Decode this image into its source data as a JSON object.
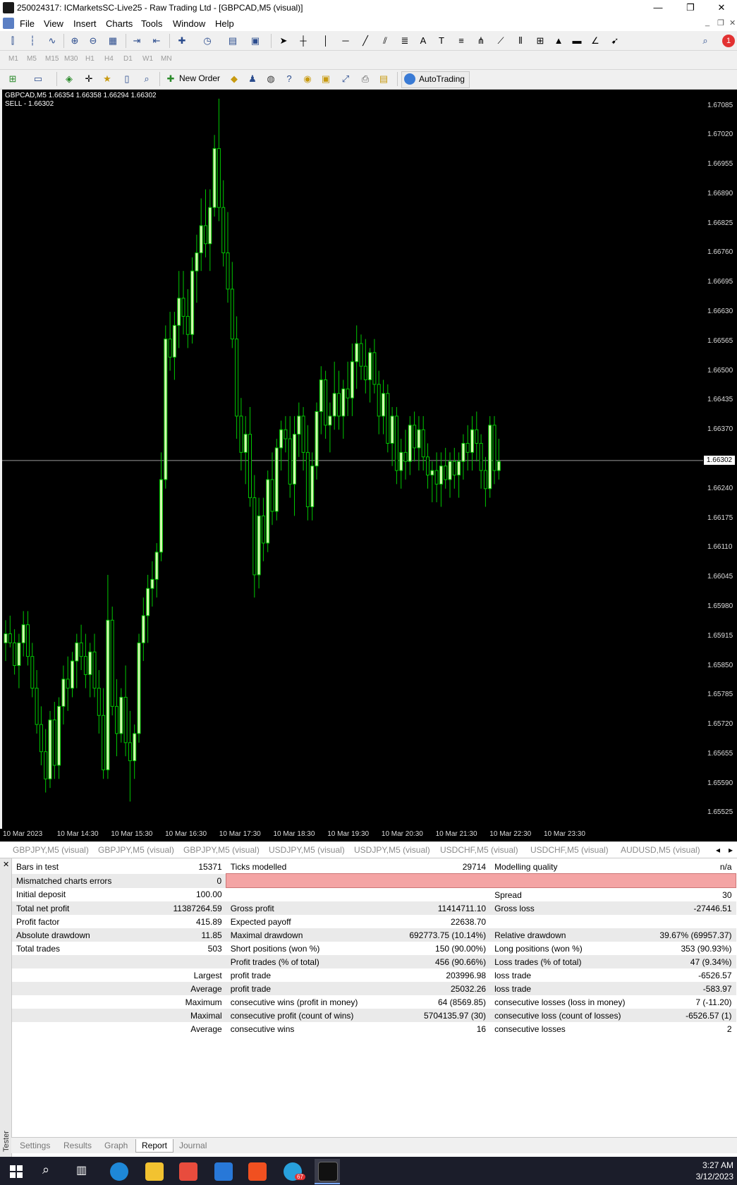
{
  "window": {
    "title": "250024317: ICMarketsSC-Live25 - Raw Trading Ltd - [GBPCAD,M5 (visual)]",
    "minimize": "—",
    "maximize": "❐",
    "close": "✕"
  },
  "menu": {
    "items": [
      "File",
      "View",
      "Insert",
      "Charts",
      "Tools",
      "Window",
      "Help"
    ],
    "mdi_min": "_",
    "mdi_restore": "❐",
    "mdi_close": "✕"
  },
  "timeframes": [
    "M1",
    "M5",
    "M15",
    "M30",
    "H1",
    "H4",
    "D1",
    "W1",
    "MN"
  ],
  "toolbar": {
    "new_order": "New Order",
    "autotrading": "AutoTrading",
    "notification_count": "1"
  },
  "chart": {
    "symbol_line": "GBPCAD,M5  1.66354 1.66358 1.66294 1.66302",
    "order_line": "SELL - 1.66302",
    "current_price": "1.66302",
    "price_ticks": [
      "1.67085",
      "1.67020",
      "1.66955",
      "1.66890",
      "1.66825",
      "1.66760",
      "1.66695",
      "1.66630",
      "1.66565",
      "1.66500",
      "1.66435",
      "1.66370",
      "1.66240",
      "1.66175",
      "1.66110",
      "1.66045",
      "1.65980",
      "1.65915",
      "1.65850",
      "1.65785",
      "1.65720",
      "1.65655",
      "1.65590",
      "1.65525"
    ],
    "time_ticks": [
      "10 Mar 2023",
      "10 Mar 14:30",
      "10 Mar 15:30",
      "10 Mar 16:30",
      "10 Mar 17:30",
      "10 Mar 18:30",
      "10 Mar 19:30",
      "10 Mar 20:30",
      "10 Mar 21:30",
      "10 Mar 22:30",
      "10 Mar 23:30"
    ],
    "bull_color": "#d4f7b0",
    "bear_color": "#000000",
    "wick_color": "#00c800"
  },
  "chart_data": {
    "type": "candlestick",
    "symbol": "GBPCAD",
    "timeframe": "M5",
    "ylim": [
      1.6549,
      1.6712
    ],
    "current_price": 1.66302,
    "ohlc": [
      [
        1.659,
        1.6595,
        1.6586,
        1.6592
      ],
      [
        1.6592,
        1.6596,
        1.6589,
        1.659
      ],
      [
        1.659,
        1.6593,
        1.6583,
        1.6585
      ],
      [
        1.6585,
        1.6592,
        1.658,
        1.659
      ],
      [
        1.659,
        1.6597,
        1.6587,
        1.6594
      ],
      [
        1.6594,
        1.6597,
        1.6585,
        1.6587
      ],
      [
        1.6587,
        1.659,
        1.6578,
        1.658
      ],
      [
        1.658,
        1.6584,
        1.657,
        1.6572
      ],
      [
        1.6572,
        1.6576,
        1.6563,
        1.6566
      ],
      [
        1.6566,
        1.6571,
        1.6557,
        1.656
      ],
      [
        1.656,
        1.6575,
        1.6558,
        1.6573
      ],
      [
        1.6573,
        1.6577,
        1.656,
        1.6563
      ],
      [
        1.6563,
        1.6578,
        1.656,
        1.6576
      ],
      [
        1.6576,
        1.6585,
        1.6572,
        1.6582
      ],
      [
        1.6582,
        1.6587,
        1.6575,
        1.658
      ],
      [
        1.658,
        1.6588,
        1.6578,
        1.6586
      ],
      [
        1.6586,
        1.6592,
        1.658,
        1.659
      ],
      [
        1.659,
        1.6594,
        1.6584,
        1.6587
      ],
      [
        1.6587,
        1.6592,
        1.658,
        1.6583
      ],
      [
        1.6583,
        1.659,
        1.6578,
        1.6588
      ],
      [
        1.6588,
        1.6592,
        1.6578,
        1.658
      ],
      [
        1.658,
        1.6584,
        1.657,
        1.6574
      ],
      [
        1.6574,
        1.658,
        1.656,
        1.6562
      ],
      [
        1.6562,
        1.6605,
        1.656,
        1.6595
      ],
      [
        1.6595,
        1.6598,
        1.6574,
        1.6576
      ],
      [
        1.6576,
        1.6582,
        1.6565,
        1.657
      ],
      [
        1.657,
        1.658,
        1.6568,
        1.6578
      ],
      [
        1.6578,
        1.6585,
        1.6565,
        1.6568
      ],
      [
        1.6568,
        1.6575,
        1.6555,
        1.6564
      ],
      [
        1.6564,
        1.6572,
        1.656,
        1.657
      ],
      [
        1.657,
        1.6592,
        1.6568,
        1.659
      ],
      [
        1.659,
        1.66,
        1.6586,
        1.6596
      ],
      [
        1.6596,
        1.6605,
        1.659,
        1.6602
      ],
      [
        1.6602,
        1.6608,
        1.6598,
        1.6604
      ],
      [
        1.6604,
        1.6612,
        1.66,
        1.661
      ],
      [
        1.661,
        1.6632,
        1.6608,
        1.6626
      ],
      [
        1.6626,
        1.666,
        1.6624,
        1.6657
      ],
      [
        1.6657,
        1.6663,
        1.665,
        1.6653
      ],
      [
        1.6653,
        1.6663,
        1.6648,
        1.666
      ],
      [
        1.666,
        1.6672,
        1.6655,
        1.6666
      ],
      [
        1.6666,
        1.6672,
        1.6658,
        1.6662
      ],
      [
        1.6662,
        1.6668,
        1.6655,
        1.6658
      ],
      [
        1.6658,
        1.6675,
        1.6656,
        1.6672
      ],
      [
        1.6672,
        1.668,
        1.6665,
        1.6676
      ],
      [
        1.6676,
        1.6688,
        1.6672,
        1.6682
      ],
      [
        1.6682,
        1.669,
        1.6675,
        1.6678
      ],
      [
        1.6678,
        1.669,
        1.6672,
        1.6686
      ],
      [
        1.6686,
        1.6702,
        1.6684,
        1.6699
      ],
      [
        1.6699,
        1.671,
        1.6683,
        1.6686
      ],
      [
        1.6686,
        1.6692,
        1.6673,
        1.6676
      ],
      [
        1.6676,
        1.6685,
        1.6665,
        1.6668
      ],
      [
        1.6668,
        1.6674,
        1.6655,
        1.6657
      ],
      [
        1.6657,
        1.6662,
        1.6635,
        1.664
      ],
      [
        1.664,
        1.6644,
        1.6628,
        1.6632
      ],
      [
        1.6632,
        1.664,
        1.6625,
        1.6636
      ],
      [
        1.6636,
        1.6642,
        1.662,
        1.6622
      ],
      [
        1.6622,
        1.6627,
        1.66,
        1.6605
      ],
      [
        1.6605,
        1.6622,
        1.6602,
        1.6618
      ],
      [
        1.6618,
        1.6622,
        1.6608,
        1.6612
      ],
      [
        1.6612,
        1.6628,
        1.661,
        1.6626
      ],
      [
        1.6626,
        1.6632,
        1.6616,
        1.6619
      ],
      [
        1.6619,
        1.6635,
        1.6617,
        1.6633
      ],
      [
        1.6633,
        1.6639,
        1.6628,
        1.6637
      ],
      [
        1.6637,
        1.664,
        1.6632,
        1.6635
      ],
      [
        1.6635,
        1.664,
        1.6622,
        1.6625
      ],
      [
        1.6625,
        1.664,
        1.6618,
        1.6636
      ],
      [
        1.6636,
        1.6643,
        1.6631,
        1.664
      ],
      [
        1.664,
        1.6642,
        1.6628,
        1.6632
      ],
      [
        1.6632,
        1.6638,
        1.6617,
        1.662
      ],
      [
        1.662,
        1.6632,
        1.6617,
        1.6629
      ],
      [
        1.6629,
        1.6643,
        1.6626,
        1.6641
      ],
      [
        1.6641,
        1.6651,
        1.6636,
        1.6648
      ],
      [
        1.6648,
        1.665,
        1.6635,
        1.6638
      ],
      [
        1.6638,
        1.6643,
        1.6632,
        1.664
      ],
      [
        1.664,
        1.6652,
        1.6637,
        1.6645
      ],
      [
        1.6645,
        1.665,
        1.6637,
        1.664
      ],
      [
        1.664,
        1.6648,
        1.6635,
        1.6646
      ],
      [
        1.6646,
        1.6652,
        1.664,
        1.6644
      ],
      [
        1.6644,
        1.6656,
        1.664,
        1.6652
      ],
      [
        1.6652,
        1.666,
        1.6646,
        1.6656
      ],
      [
        1.6656,
        1.6658,
        1.6648,
        1.6651
      ],
      [
        1.6651,
        1.6657,
        1.6645,
        1.6648
      ],
      [
        1.6648,
        1.6655,
        1.6643,
        1.6654
      ],
      [
        1.6654,
        1.6657,
        1.6645,
        1.6647
      ],
      [
        1.6647,
        1.665,
        1.6636,
        1.664
      ],
      [
        1.664,
        1.6648,
        1.6636,
        1.6645
      ],
      [
        1.6645,
        1.6647,
        1.6632,
        1.6634
      ],
      [
        1.6634,
        1.6642,
        1.6629,
        1.664
      ],
      [
        1.664,
        1.6642,
        1.6625,
        1.6628
      ],
      [
        1.6628,
        1.6635,
        1.6624,
        1.6632
      ],
      [
        1.6632,
        1.6637,
        1.6626,
        1.663
      ],
      [
        1.663,
        1.664,
        1.6627,
        1.6638
      ],
      [
        1.6638,
        1.6641,
        1.663,
        1.6633
      ],
      [
        1.6633,
        1.664,
        1.6628,
        1.6637
      ],
      [
        1.6637,
        1.664,
        1.6628,
        1.6631
      ],
      [
        1.6631,
        1.6634,
        1.6624,
        1.6627
      ],
      [
        1.6627,
        1.663,
        1.6621,
        1.6628
      ],
      [
        1.6628,
        1.6632,
        1.6621,
        1.6625
      ],
      [
        1.6625,
        1.6632,
        1.662,
        1.6629
      ],
      [
        1.6629,
        1.6633,
        1.6624,
        1.6626
      ],
      [
        1.6626,
        1.6632,
        1.6622,
        1.663
      ],
      [
        1.663,
        1.6633,
        1.6624,
        1.6627
      ],
      [
        1.6627,
        1.6632,
        1.6622,
        1.663
      ],
      [
        1.663,
        1.6636,
        1.6626,
        1.6634
      ],
      [
        1.6634,
        1.6638,
        1.6628,
        1.6632
      ],
      [
        1.6632,
        1.664,
        1.6628,
        1.6637
      ],
      [
        1.6637,
        1.6641,
        1.663,
        1.6634
      ],
      [
        1.6634,
        1.6636,
        1.6624,
        1.6628
      ],
      [
        1.6628,
        1.6631,
        1.662,
        1.6624
      ],
      [
        1.6624,
        1.664,
        1.6622,
        1.6638
      ],
      [
        1.6638,
        1.664,
        1.6625,
        1.6628
      ],
      [
        1.6628,
        1.6635,
        1.6626,
        1.663
      ]
    ]
  },
  "chart_tabs": [
    "GBPJPY,M5 (visual)",
    "GBPJPY,M5 (visual)",
    "GBPJPY,M5 (visual)",
    "USDJPY,M5 (visual)",
    "USDJPY,M5 (visual)",
    "USDCHF,M5 (visual)",
    "USDCHF,M5 (visual)",
    "AUDUSD,M5 (visual)"
  ],
  "tester": {
    "label": "Tester",
    "close": "✕",
    "report": [
      [
        "Bars in test",
        "15371",
        "Ticks modelled",
        "29714",
        "Modelling quality",
        "n/a"
      ],
      [
        "Mismatched charts errors",
        "0",
        "",
        "",
        "",
        ""
      ],
      [
        "Initial deposit",
        "100.00",
        "",
        "",
        "Spread",
        "30"
      ],
      [
        "Total net profit",
        "11387264.59",
        "Gross profit",
        "11414711.10",
        "Gross loss",
        "-27446.51"
      ],
      [
        "Profit factor",
        "415.89",
        "Expected payoff",
        "22638.70",
        "",
        ""
      ],
      [
        "Absolute drawdown",
        "11.85",
        "Maximal drawdown",
        "692773.75 (10.14%)",
        "Relative drawdown",
        "39.67% (69957.37)"
      ],
      [
        "Total trades",
        "503",
        "Short positions (won %)",
        "150 (90.00%)",
        "Long positions (won %)",
        "353 (90.93%)"
      ],
      [
        "",
        "",
        "Profit trades (% of total)",
        "456 (90.66%)",
        "Loss trades (% of total)",
        "47 (9.34%)"
      ],
      [
        "",
        "Largest",
        "profit trade",
        "203996.98",
        "loss trade",
        "-6526.57"
      ],
      [
        "",
        "Average",
        "profit trade",
        "25032.26",
        "loss trade",
        "-583.97"
      ],
      [
        "",
        "Maximum",
        "consecutive wins (profit in money)",
        "64 (8569.85)",
        "consecutive losses (loss in money)",
        "7 (-11.20)"
      ],
      [
        "",
        "Maximal",
        "consecutive profit (count of wins)",
        "5704135.97 (30)",
        "consecutive loss (count of losses)",
        "-6526.57 (1)"
      ],
      [
        "",
        "Average",
        "consecutive wins",
        "16",
        "consecutive losses",
        "2"
      ]
    ],
    "tabs": [
      "Settings",
      "Results",
      "Graph",
      "Report",
      "Journal"
    ],
    "active_tab": "Report"
  },
  "taskbar": {
    "time": "3:27 AM",
    "date": "3/12/2023",
    "telegram_badge": "67",
    "pinned": [
      "start-icon",
      "search-icon",
      "task-view-icon",
      "edge-icon",
      "file-explorer-icon",
      "store-icon",
      "mail-icon",
      "brave-icon",
      "telegram-icon",
      "mt4-icon"
    ]
  }
}
